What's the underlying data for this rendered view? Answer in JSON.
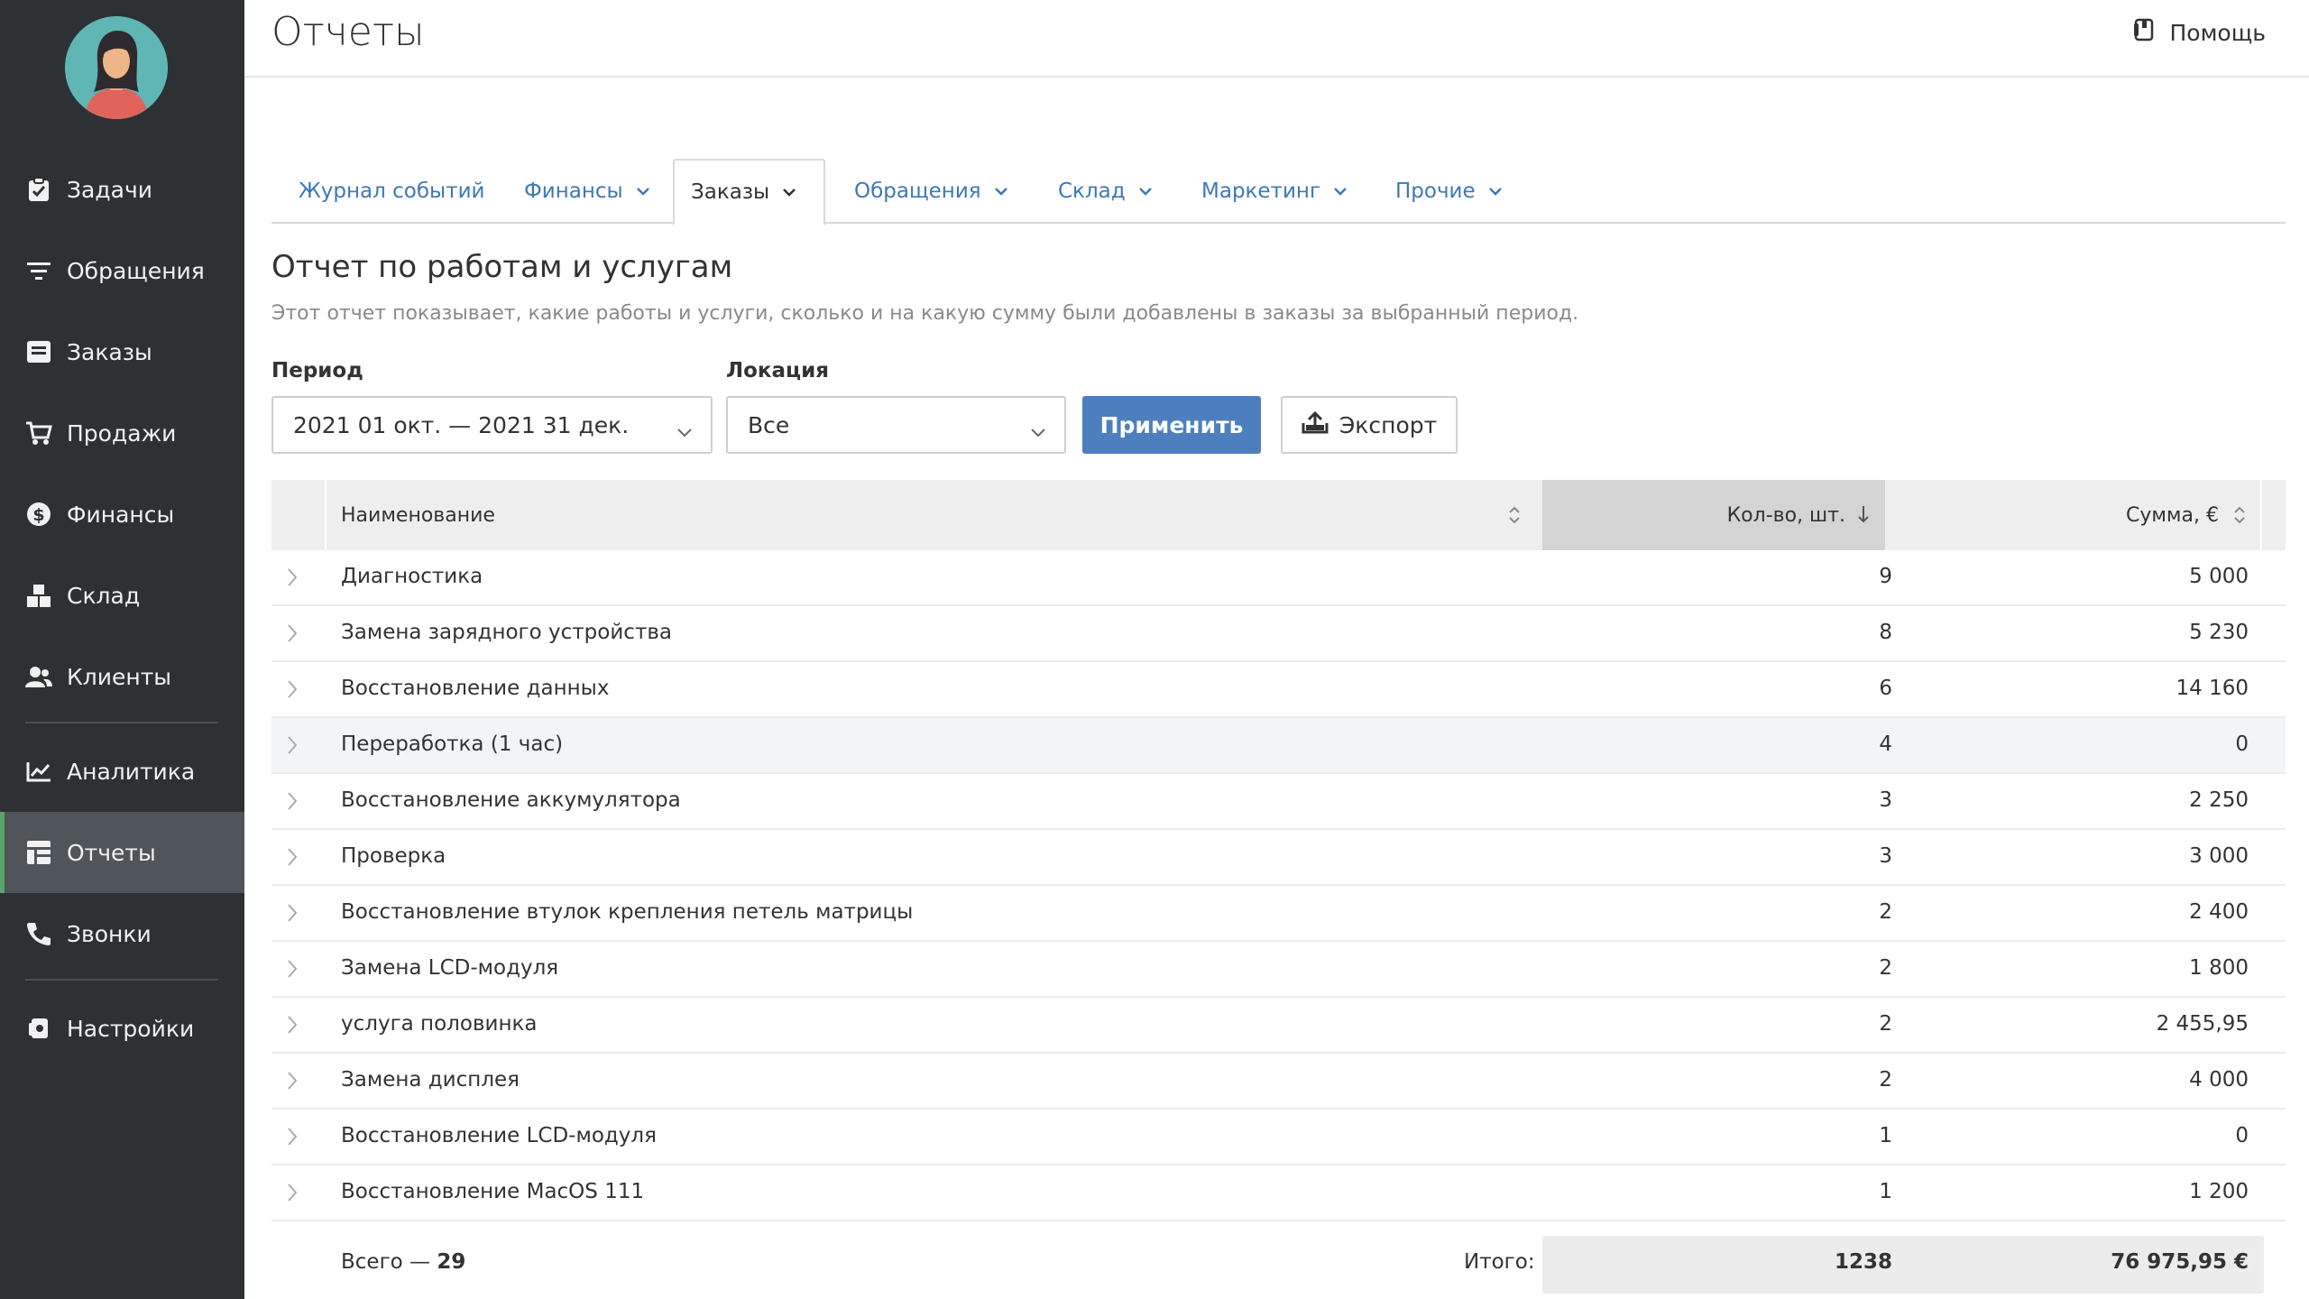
{
  "header": {
    "title": "Отчеты",
    "help_label": "Помощь"
  },
  "sidebar": {
    "items": [
      {
        "label": "Задачи",
        "icon": "clipboard-icon"
      },
      {
        "label": "Обращения",
        "icon": "funnel-icon"
      },
      {
        "label": "Заказы",
        "icon": "inbox-icon"
      },
      {
        "label": "Продажи",
        "icon": "cart-icon"
      },
      {
        "label": "Финансы",
        "icon": "dollar-icon"
      },
      {
        "label": "Склад",
        "icon": "boxes-icon"
      },
      {
        "label": "Клиенты",
        "icon": "users-icon"
      },
      {
        "label": "Аналитика",
        "icon": "chart-line-icon"
      },
      {
        "label": "Отчеты",
        "icon": "table-icon",
        "active": true
      },
      {
        "label": "Звонки",
        "icon": "phone-icon"
      },
      {
        "label": "Настройки",
        "icon": "gear-icon"
      }
    ]
  },
  "tabs": [
    {
      "label": "Журнал событий",
      "dropdown": false
    },
    {
      "label": "Финансы",
      "dropdown": true
    },
    {
      "label": "Заказы",
      "dropdown": true,
      "active": true
    },
    {
      "label": "Обращения",
      "dropdown": true
    },
    {
      "label": "Склад",
      "dropdown": true
    },
    {
      "label": "Маркетинг",
      "dropdown": true
    },
    {
      "label": "Прочие",
      "dropdown": true
    }
  ],
  "report": {
    "title": "Отчет по работам и услугам",
    "description": "Этот отчет показывает, какие работы и услуги, сколько и на какую сумму были добавлены в заказы за выбранный период."
  },
  "filters": {
    "period_label": "Период",
    "period_value": "2021 01 окт. — 2021 31 дек.",
    "location_label": "Локация",
    "location_value": "Все",
    "apply_label": "Применить",
    "export_label": "Экспорт"
  },
  "table": {
    "columns": {
      "name": "Наименование",
      "qty": "Кол-во, шт.",
      "sum": "Сумма, €"
    },
    "rows": [
      {
        "name": "Диагностика",
        "qty": "9",
        "sum": "5 000"
      },
      {
        "name": "Замена зарядного устройства",
        "qty": "8",
        "sum": "5 230"
      },
      {
        "name": "Восстановление данных",
        "qty": "6",
        "sum": "14 160"
      },
      {
        "name": "Переработка (1 час)",
        "qty": "4",
        "sum": "0"
      },
      {
        "name": "Восстановление аккумулятора",
        "qty": "3",
        "sum": "2 250"
      },
      {
        "name": "Проверка",
        "qty": "3",
        "sum": "3 000"
      },
      {
        "name": "Восстановление втулок крепления петель матрицы",
        "qty": "2",
        "sum": "2 400"
      },
      {
        "name": "Замена LCD-модуля",
        "qty": "2",
        "sum": "1 800"
      },
      {
        "name": "услуга половинка",
        "qty": "2",
        "sum": "2 455,95"
      },
      {
        "name": "Замена дисплея",
        "qty": "2",
        "sum": "4 000"
      },
      {
        "name": "Восстановление LCD-модуля",
        "qty": "1",
        "sum": "0"
      },
      {
        "name": "Восстановление MacOS 111",
        "qty": "1",
        "sum": "1 200"
      }
    ],
    "footer": {
      "count_prefix": "Всего — ",
      "count_value": "29",
      "itogo_label": "Итого:",
      "total_qty": "1238",
      "total_sum": "76 975,95 €"
    }
  },
  "colors": {
    "sidebar_bg": "#2d3134",
    "sidebar_active": "#4f5559",
    "accent_green": "#5aa36a",
    "link_blue": "#3e78b8",
    "button_blue": "#4d7fbf"
  }
}
